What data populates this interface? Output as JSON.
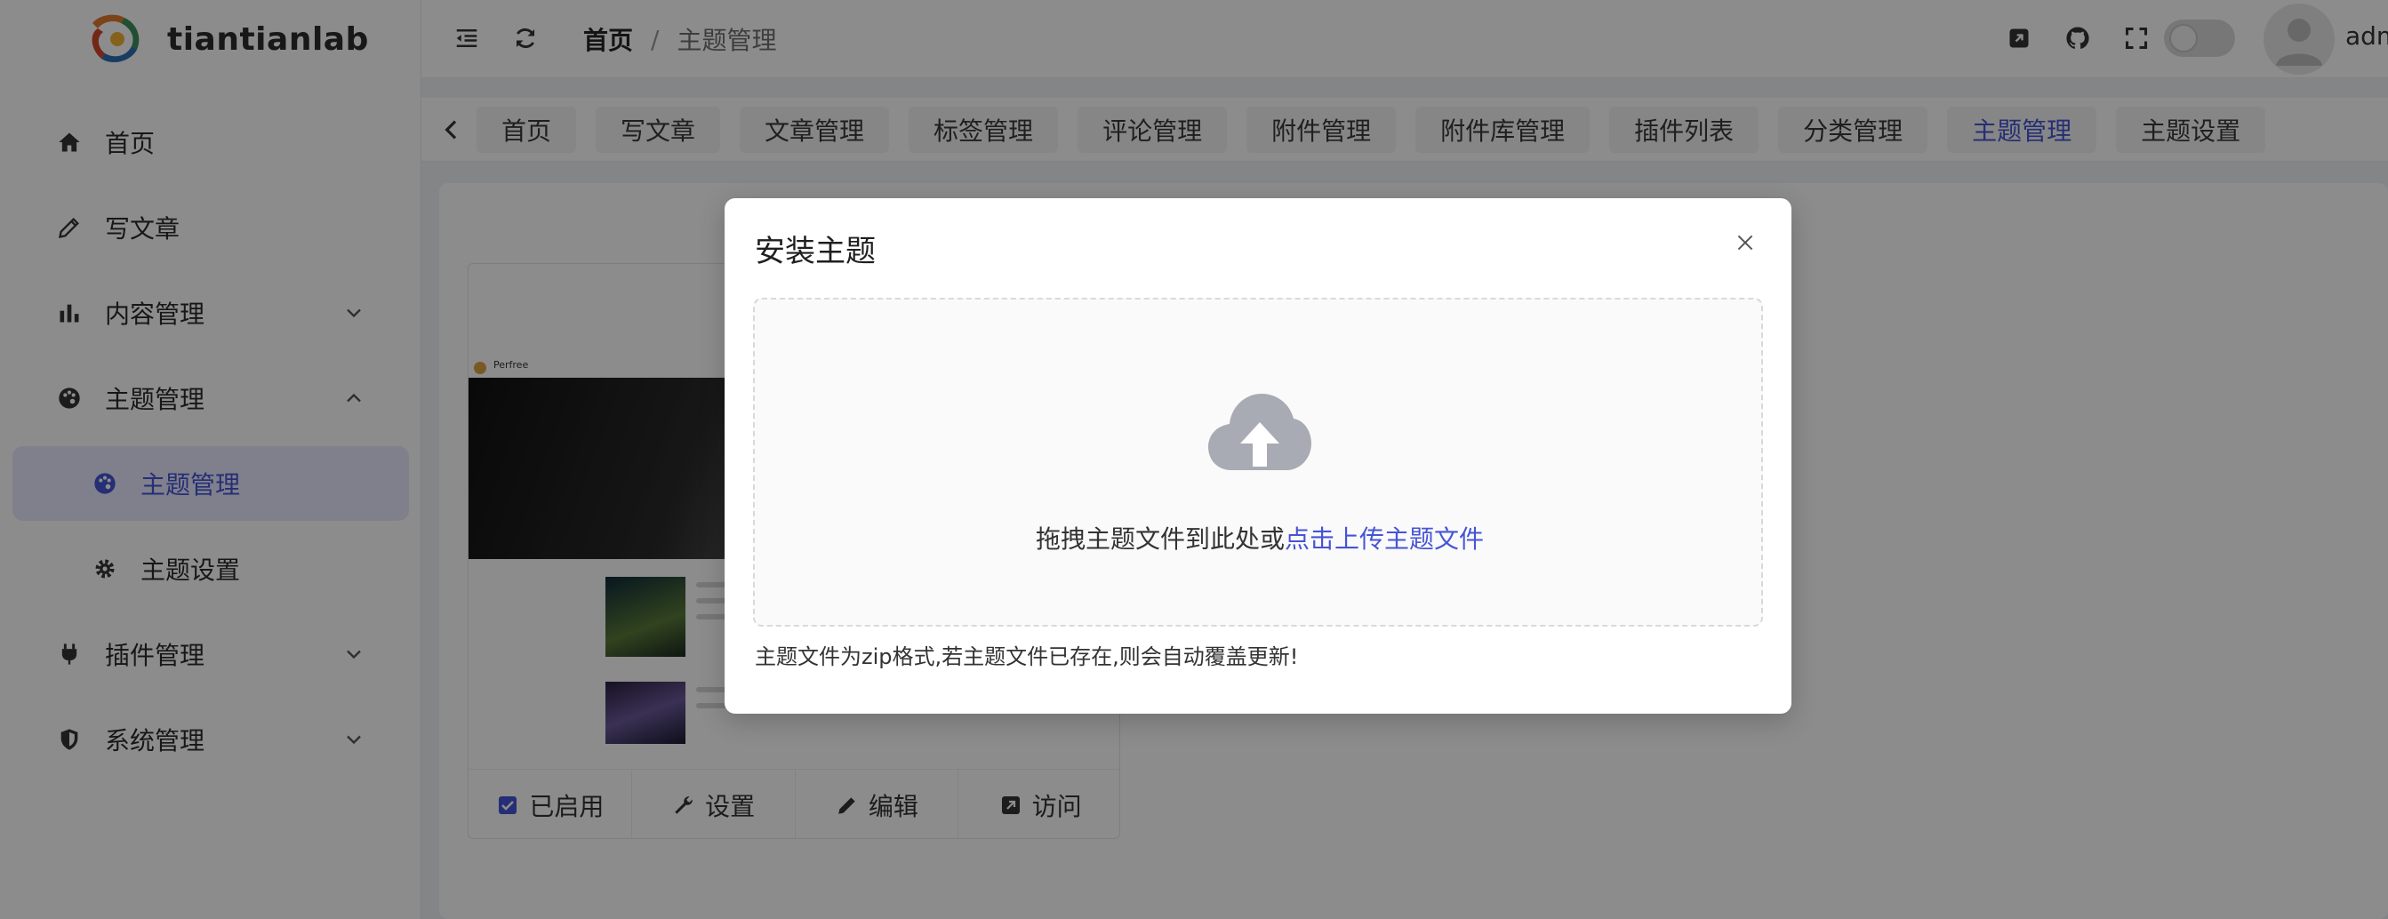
{
  "brand": {
    "name": "tiantianlab"
  },
  "header": {
    "breadcrumb": {
      "home": "首页",
      "separator": "/",
      "current": "主题管理"
    },
    "user": "adm"
  },
  "sidebar": {
    "items": [
      {
        "label": "首页",
        "icon": "home-icon"
      },
      {
        "label": "写文章",
        "icon": "pencil-icon"
      },
      {
        "label": "内容管理",
        "icon": "bar-chart-icon"
      },
      {
        "label": "主题管理",
        "icon": "palette-icon"
      },
      {
        "label": "主题管理",
        "icon": "palette-icon"
      },
      {
        "label": "主题设置",
        "icon": "gear-icon"
      },
      {
        "label": "插件管理",
        "icon": "plug-icon"
      },
      {
        "label": "系统管理",
        "icon": "shield-icon"
      }
    ]
  },
  "tabs": [
    "首页",
    "写文章",
    "文章管理",
    "标签管理",
    "评论管理",
    "附件管理",
    "附件库管理",
    "插件列表",
    "分类管理",
    "主题管理",
    "主题设置"
  ],
  "theme_card": {
    "preview_brand": "Perfree",
    "actions": {
      "enabled": "已启用",
      "settings": "设置",
      "edit": "编辑",
      "visit": "访问"
    }
  },
  "modal": {
    "title": "安装主题",
    "drop_text": "拖拽主题文件到此处或",
    "drop_link": "点击上传主题文件",
    "tip": "主题文件为zip格式,若主题文件已存在,则会自动覆盖更新!"
  },
  "colors": {
    "accent": "#4654d6",
    "active_bg": "#e7eaff",
    "mask": "rgba(0,0,0,0.45)"
  }
}
